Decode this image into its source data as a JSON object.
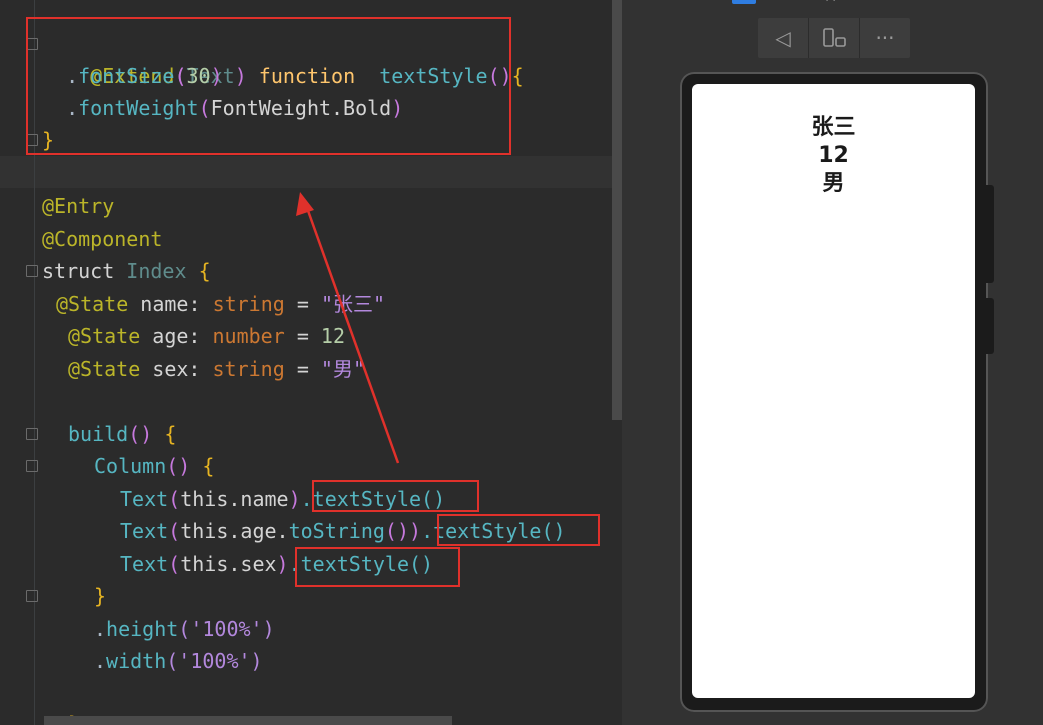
{
  "editor": {
    "extend_line": {
      "at": "@",
      "extend": "Extend",
      "lparen": "(",
      "arg": "Text",
      "rparen": ")",
      "keyword": "function",
      "name": "textStyle",
      "parens": "()",
      "brace": "{"
    },
    "font_size_line": {
      "dot": ".",
      "method": "fontSize",
      "lparen": "(",
      "value": "30",
      "rparen": ")"
    },
    "font_weight_line": {
      "dot": ".",
      "method": "fontWeight",
      "lparen": "(",
      "value": "FontWeight.Bold",
      "rparen": ")"
    },
    "close_extend": "}",
    "entry": "@Entry",
    "component": "@Component",
    "struct_line": {
      "keyword": "struct",
      "name": "Index",
      "brace": "{"
    },
    "state_name": {
      "decorator": "@State",
      "name": "name",
      "colon": ":",
      "type": "string",
      "eq": "=",
      "value": "\"张三\""
    },
    "state_age": {
      "decorator": "@State",
      "name": "age",
      "colon": ":",
      "type": "number",
      "eq": "=",
      "value": "12"
    },
    "state_sex": {
      "decorator": "@State",
      "name": "sex",
      "colon": ":",
      "type": "string",
      "eq": "=",
      "value": "\"男\""
    },
    "build_line": {
      "name": "build",
      "parens": "()",
      "brace": "{"
    },
    "column_line": {
      "name": "Column",
      "parens": "()",
      "brace": "{"
    },
    "text1": {
      "name": "Text",
      "lparen": "(",
      "arg": "this.name",
      "rparen": ")",
      "chain": ".textStyle()"
    },
    "text2": {
      "name": "Text",
      "lparen": "(",
      "arg": "this.age.",
      "call": "toString",
      "inner": "()",
      "rparen": ")",
      "chain": ".textStyle()"
    },
    "text3": {
      "name": "Text",
      "lparen": "(",
      "arg": "this.sex",
      "rparen": ")",
      "chain": ".textStyle()"
    },
    "close_column": "}",
    "height_line": {
      "dot": ".",
      "method": "height",
      "arg": "('100%')"
    },
    "width_line": {
      "dot": ".",
      "method": "width",
      "arg": "('100%')"
    },
    "close_partial": "}"
  },
  "preview": {
    "toolbar": {
      "back_icon": "◁",
      "rotate_icon": "▯▫",
      "more_icon": "···"
    },
    "top_text": "(   )",
    "screen_text": [
      "张三",
      "12",
      "男"
    ]
  },
  "colors": {
    "highlight_box": "#e0312b",
    "editor_bg": "#2b2b2b",
    "preview_bg": "#323232"
  }
}
